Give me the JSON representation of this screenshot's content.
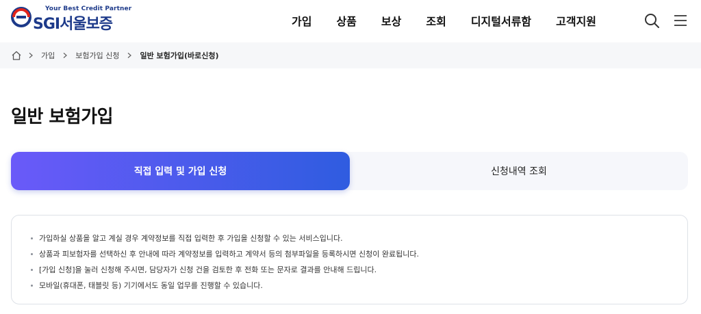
{
  "header": {
    "tagline": "Your Best Credit Partner",
    "logo_text": "SGI서울보증",
    "nav": [
      "가입",
      "상품",
      "보상",
      "조회",
      "디지털서류함",
      "고객지원"
    ],
    "icons": [
      "search-icon",
      "menu-icon"
    ],
    "brand_blue": "#1d3a8a",
    "brand_red": "#e2231a"
  },
  "breadcrumb": {
    "items": [
      "가입",
      "보험가입 신청",
      "일반 보험가입(바로신청)"
    ]
  },
  "page": {
    "title": "일반 보험가입"
  },
  "tabs": [
    {
      "label": "직접 입력 및 가입 신청",
      "active": true
    },
    {
      "label": "신청내역 조회",
      "active": false
    }
  ],
  "tab_gradient": [
    "#6a5af9",
    "#2f5ce0"
  ],
  "info": {
    "lines": [
      "가입하실 상품을 알고 계실 경우 계약정보를 직접 입력한 후 가입을 신청할 수 있는 서비스입니다.",
      "상품과 피보험자를 선택하신 후 안내에 따라 계약정보를 입력하고 계약서 등의 첨부파일을 등록하시면 신청이 완료됩니다.",
      "[가입 신청]을 눌러 신청해 주시면, 담당자가 신청 건을 검토한 후 전화 또는 문자로 결과를 안내해 드립니다.",
      "모바일(휴대폰, 태블릿 등) 기기에서도 동일 업무를 진행할 수 있습니다."
    ]
  }
}
